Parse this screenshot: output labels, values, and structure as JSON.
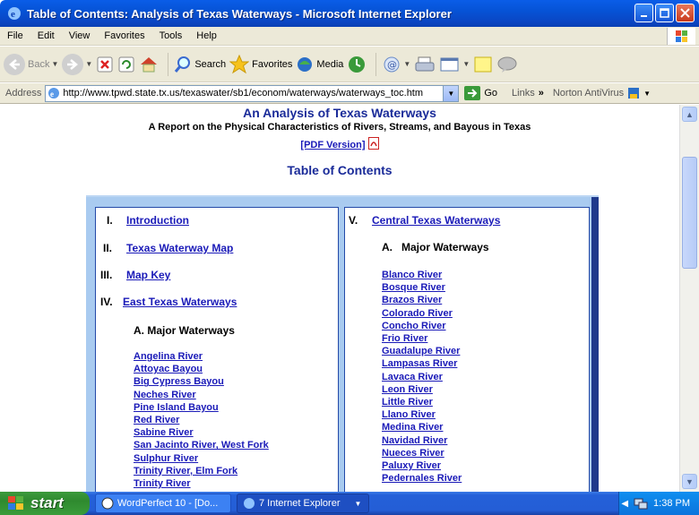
{
  "window": {
    "title": "Table of Contents: Analysis of Texas Waterways - Microsoft Internet Explorer"
  },
  "menu": [
    "File",
    "Edit",
    "View",
    "Favorites",
    "Tools",
    "Help"
  ],
  "toolbar": {
    "back": "Back",
    "search": "Search",
    "favorites": "Favorites",
    "media": "Media"
  },
  "address": {
    "label": "Address",
    "url": "http://www.tpwd.state.tx.us/texaswater/sb1/econom/waterways/waterways_toc.htm",
    "go": "Go",
    "links": "Links",
    "links_more": "»",
    "norton": "Norton AntiVirus"
  },
  "page": {
    "title": "An Analysis of Texas Waterways",
    "subtitle": "A Report on the Physical Characteristics of Rivers, Streams, and Bayous in Texas",
    "pdf_link": "[PDF Version]",
    "toc_heading": "Table of Contents"
  },
  "toc": {
    "left": [
      {
        "num": "I.",
        "label": "Introduction"
      },
      {
        "num": "II.",
        "label": "Texas Waterway Map"
      },
      {
        "num": "III.",
        "label": "Map Key"
      },
      {
        "num": "IV.",
        "label": "East Texas Waterways"
      }
    ],
    "left_sub": {
      "letter": "A.",
      "label": "Major Waterways"
    },
    "left_rivers": [
      "Angelina River",
      "Attoyac Bayou",
      "Big Cypress Bayou",
      "Neches River",
      "Pine Island Bayou",
      "Red River",
      "Sabine River",
      "San Jacinto River, West Fork",
      "Sulphur River",
      "Trinity River, Elm Fork",
      "Trinity River"
    ],
    "right": {
      "num": "V.",
      "label": "Central Texas Waterways"
    },
    "right_sub": {
      "letter": "A.",
      "label": "Major Waterways"
    },
    "right_rivers": [
      "Blanco River",
      "Bosque River",
      "Brazos River",
      "Colorado River",
      "Concho River",
      "Frio River",
      "Guadalupe River",
      "Lampasas River",
      "Lavaca River",
      "Leon River",
      "Little River",
      "Llano River",
      "Medina River",
      "Navidad River",
      "Nueces River",
      "Paluxy River",
      "Pedernales River"
    ]
  },
  "taskbar": {
    "start": "start",
    "task1": "WordPerfect 10 - [Do...",
    "task2": "7 Internet Explorer",
    "clock": "1:38 PM"
  }
}
